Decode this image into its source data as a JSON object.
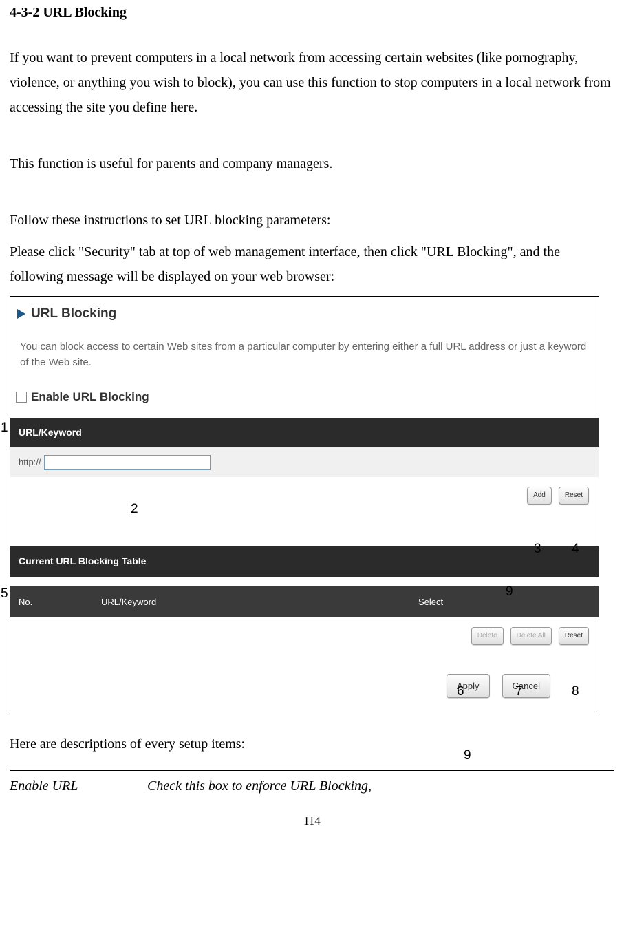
{
  "section_title": "4-3-2 URL Blocking",
  "paragraphs": {
    "p1": "If you want to prevent computers in a local network from accessing certain websites (like pornography, violence, or anything you wish to block), you can use this function to stop computers in a local network from accessing the site you define here.",
    "p2": "This function is useful for parents and company managers.",
    "p3": "Follow these instructions to set URL blocking parameters:",
    "p4": "Please click \"Security\" tab at top of web management interface, then click \"URL Blocking\", and the following message will be displayed on your web browser:"
  },
  "screenshot": {
    "title": "URL Blocking",
    "description": "You can block access to certain Web sites from a particular computer by entering either a full URL address or just a keyword of the Web site.",
    "enable_label": "Enable URL Blocking",
    "section_url_keyword": "URL/Keyword",
    "http_prefix": "http://",
    "btn_add": "Add",
    "btn_reset": "Reset",
    "section_current_table": "Current URL Blocking Table",
    "col_no": "No.",
    "col_url": "URL/Keyword",
    "col_select": "Select",
    "btn_delete": "Delete",
    "btn_delete_all": "Delete All",
    "btn_reset2": "Reset",
    "btn_apply": "Apply",
    "btn_cancel": "Cancel"
  },
  "annotations": {
    "a1": "1",
    "a2": "2",
    "a3": "3",
    "a4": "4",
    "a5": "5",
    "a6": "6",
    "a7": "7",
    "a8": "8",
    "a9a": "9",
    "a9b": "9"
  },
  "desc_heading": "Here are descriptions of every setup items:",
  "item": {
    "label": "Enable URL",
    "desc": "Check this box to enforce URL Blocking,"
  },
  "page_number": "114"
}
